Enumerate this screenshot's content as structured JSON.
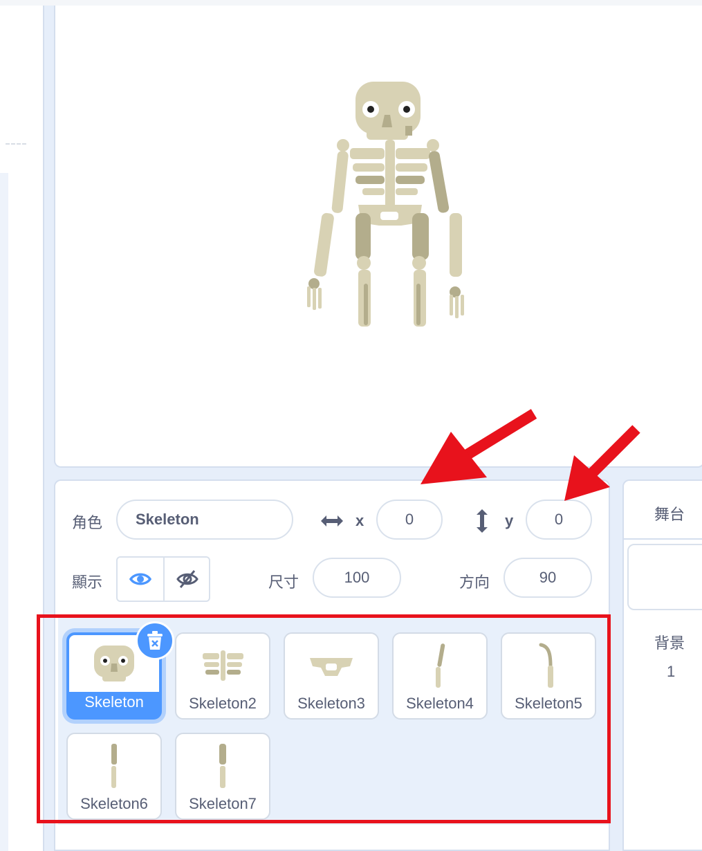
{
  "sprite_info": {
    "sprite_label": "角色",
    "sprite_name": "Skeleton",
    "x_label": "x",
    "x_value": "0",
    "y_label": "y",
    "y_value": "0",
    "show_label": "顯示",
    "size_label": "尺寸",
    "size_value": "100",
    "direction_label": "方向",
    "direction_value": "90"
  },
  "sprites": [
    {
      "name": "Skeleton",
      "selected": true
    },
    {
      "name": "Skeleton2",
      "selected": false
    },
    {
      "name": "Skeleton3",
      "selected": false
    },
    {
      "name": "Skeleton4",
      "selected": false
    },
    {
      "name": "Skeleton5",
      "selected": false
    },
    {
      "name": "Skeleton6",
      "selected": false
    },
    {
      "name": "Skeleton7",
      "selected": false
    }
  ],
  "stage_pane": {
    "title": "舞台",
    "backdrops_label": "背景",
    "backdrops_count": "1"
  },
  "colors": {
    "accent": "#4c97ff",
    "annotation": "#e8121c",
    "bone": "#d8d2b4",
    "bone_dark": "#b3ad8c"
  },
  "icons": [
    "eye-icon",
    "eye-slash-icon",
    "horizontal-arrow-icon",
    "vertical-arrow-icon",
    "trash-icon"
  ]
}
